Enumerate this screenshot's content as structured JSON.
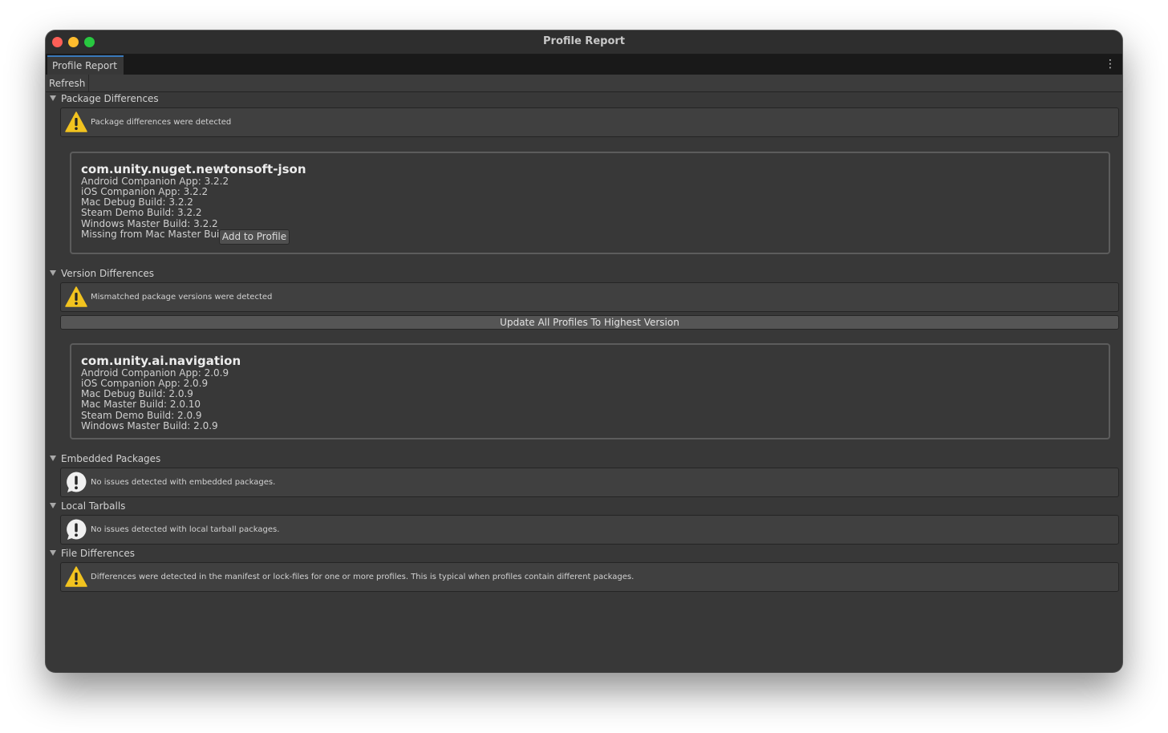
{
  "window": {
    "title": "Profile Report"
  },
  "tab": {
    "label": "Profile Report"
  },
  "toolbar": {
    "refresh_label": "Refresh"
  },
  "sections": {
    "package_differences": {
      "title": "Package Differences",
      "message": "Package differences were detected",
      "card": {
        "package": "com.unity.nuget.newtonsoft-json",
        "lines": [
          "Android Companion App: 3.2.2",
          "iOS Companion App: 3.2.2",
          "Mac Debug Build: 3.2.2",
          "Steam Demo Build: 3.2.2",
          "Windows Master Build: 3.2.2"
        ],
        "missing_text": "Missing from Mac Master Build",
        "add_button_label": "Add to Profile"
      }
    },
    "version_differences": {
      "title": "Version Differences",
      "message": "Mismatched package versions were detected",
      "update_button_label": "Update All Profiles To Highest Version",
      "card": {
        "package": "com.unity.ai.navigation",
        "lines": [
          "Android Companion App: 2.0.9",
          "iOS Companion App: 2.0.9",
          "Mac Debug Build: 2.0.9",
          "Mac Master Build: 2.0.10",
          "Steam Demo Build: 2.0.9",
          "Windows Master Build: 2.0.9"
        ]
      }
    },
    "embedded_packages": {
      "title": "Embedded Packages",
      "message": "No issues detected with embedded packages."
    },
    "local_tarballs": {
      "title": "Local Tarballs",
      "message": "No issues detected with local tarball packages."
    },
    "file_differences": {
      "title": "File Differences",
      "message": "Differences were detected in the manifest or lock-files for one or more profiles. This is typical when profiles contain different packages."
    }
  },
  "icons": {
    "warning": "warning-icon",
    "info": "info-icon",
    "more": "more-vertical-icon"
  },
  "colors": {
    "window_background": "#383838",
    "warning_yellow": "#f2c31f",
    "tab_accent": "#3a79bb"
  }
}
